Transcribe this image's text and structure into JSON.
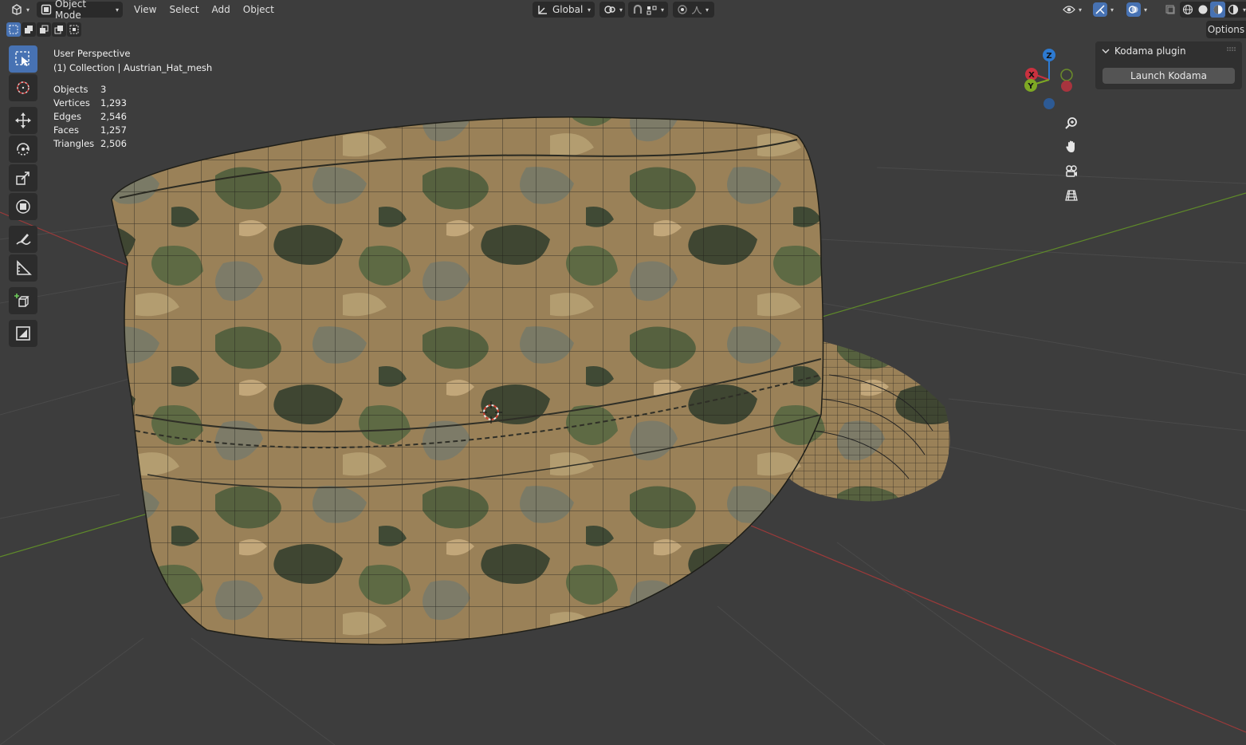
{
  "header": {
    "editor_type_icon": "viewport-editor-icon",
    "mode": {
      "label": "Object Mode",
      "icon": "object-mode-icon"
    },
    "menus": [
      "View",
      "Select",
      "Add",
      "Object"
    ],
    "transform_orientation": {
      "label": "Global",
      "icon": "transform-orientation-icon"
    },
    "pivot_icon": "pivot-point-icon",
    "snap_icon": "snap-magnet-icon",
    "snap_target_icon": "snap-increment-icon",
    "proportional_icon": "proportional-editing-icon",
    "falloff_icon": "falloff-curve-icon",
    "right_icons": [
      "visibility-icon",
      "gizmo-icon",
      "overlay-icon",
      "xray-icon",
      "wireframe-shading-icon",
      "solid-shading-icon",
      "material-preview-icon",
      "rendered-shading-icon"
    ]
  },
  "selection_modes": [
    "select-new-icon",
    "select-extend-icon",
    "select-subtract-icon",
    "select-invert-icon",
    "select-intersect-icon"
  ],
  "toolbar": [
    "select-box-icon",
    "cursor-icon",
    "move-icon",
    "rotate-icon",
    "scale-icon",
    "transform-icon",
    "annotate-icon",
    "measure-icon",
    "add-cube-icon",
    "image-tool-icon"
  ],
  "overlay": {
    "view_name": "User Perspective",
    "collection": "(1) Collection | Austrian_Hat_mesh",
    "stats": [
      {
        "label": "Objects",
        "value": "3"
      },
      {
        "label": "Vertices",
        "value": "1,293"
      },
      {
        "label": "Edges",
        "value": "2,546"
      },
      {
        "label": "Faces",
        "value": "1,257"
      },
      {
        "label": "Triangles",
        "value": "2,506"
      }
    ]
  },
  "gizmo": {
    "x": "X",
    "y": "Y",
    "z": "Z",
    "colors": {
      "x": "#c9313f",
      "y": "#7ea824",
      "z": "#2d7ad1"
    }
  },
  "nav_buttons": [
    "zoom-icon",
    "pan-hand-icon",
    "camera-view-icon",
    "perspective-grid-icon"
  ],
  "options_label": "Options",
  "panel": {
    "title": "Kodama plugin",
    "button_label": "Launch Kodama"
  },
  "colors": {
    "accent": "#4772b3",
    "background": "#3d3d3d",
    "x_axis": "#9c3a3a",
    "y_axis": "#5f8a2a"
  }
}
